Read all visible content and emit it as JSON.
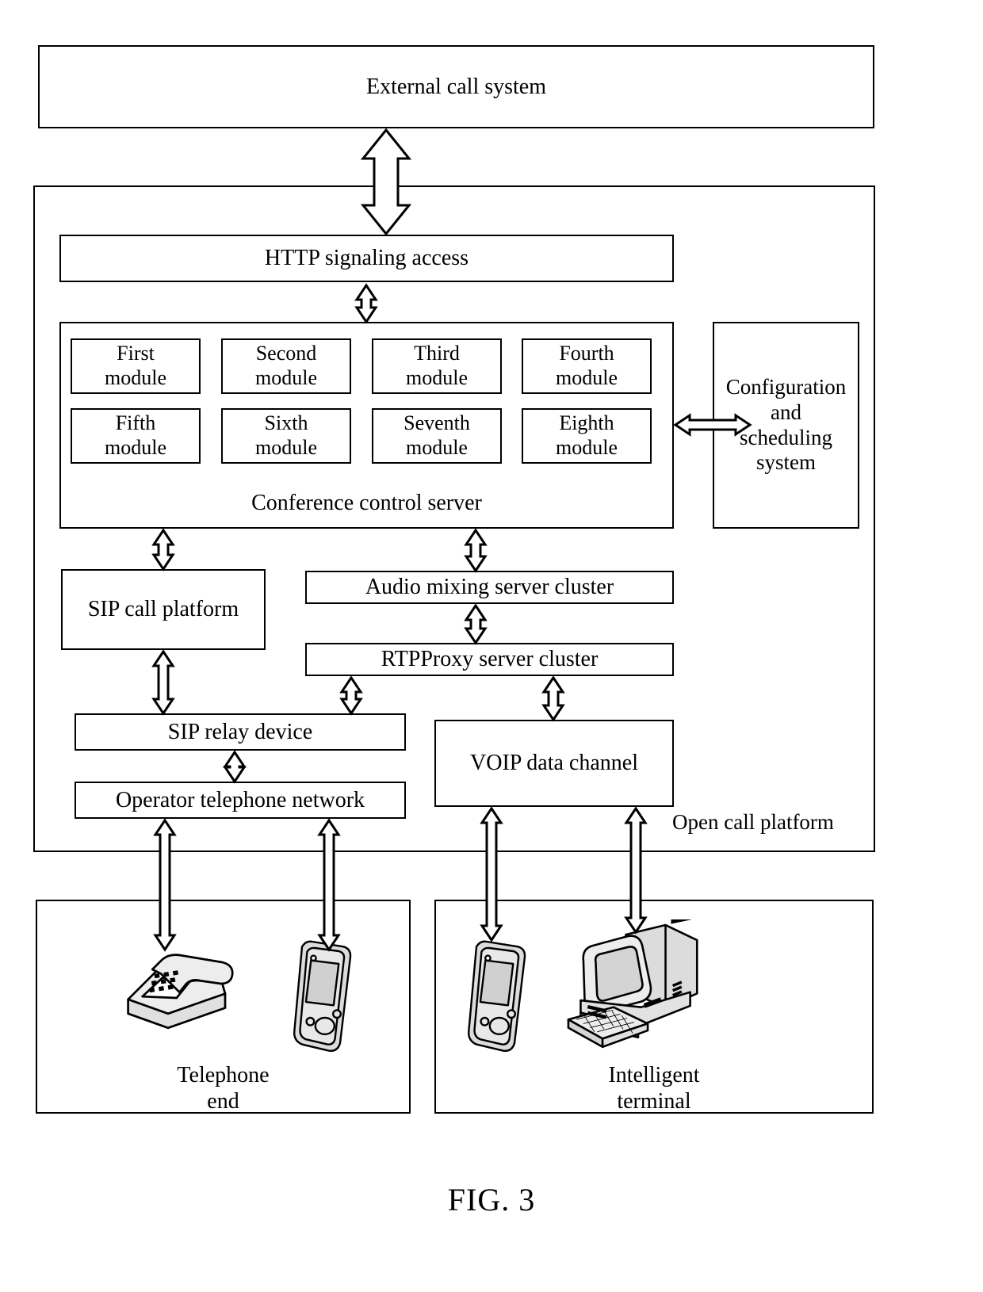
{
  "figure": {
    "caption": "FIG. 3"
  },
  "external": {
    "title": "External call system"
  },
  "platform": {
    "label": "Open call platform",
    "http_access": "HTTP signaling access",
    "conference_server": {
      "title": "Conference control server",
      "modules": [
        {
          "label": "First\nmodule"
        },
        {
          "label": "Second\nmodule"
        },
        {
          "label": "Third\nmodule"
        },
        {
          "label": "Fourth\nmodule"
        },
        {
          "label": "Fifth\nmodule"
        },
        {
          "label": "Sixth\nmodule"
        },
        {
          "label": "Seventh\nmodule"
        },
        {
          "label": "Eighth\nmodule"
        }
      ]
    },
    "config_system": "Configuration\nand\nscheduling\nsystem",
    "sip_call_platform": "SIP call platform",
    "audio_mixing_cluster": "Audio mixing server cluster",
    "rtpproxy_cluster": "RTPProxy server cluster",
    "sip_relay_device": "SIP relay device",
    "operator_network": "Operator telephone network",
    "voip_channel": "VOIP data channel"
  },
  "endpoints": {
    "telephone_end": {
      "label": "Telephone\nend",
      "devices": [
        "desk-phone-icon",
        "mobile-phone-icon"
      ]
    },
    "intelligent_terminal": {
      "label": "Intelligent\nterminal",
      "devices": [
        "pda-phone-icon",
        "desktop-computer-icon"
      ]
    }
  },
  "colors": {
    "stroke": "#000000",
    "background": "#ffffff",
    "device_fill": "#e8e8e8"
  }
}
